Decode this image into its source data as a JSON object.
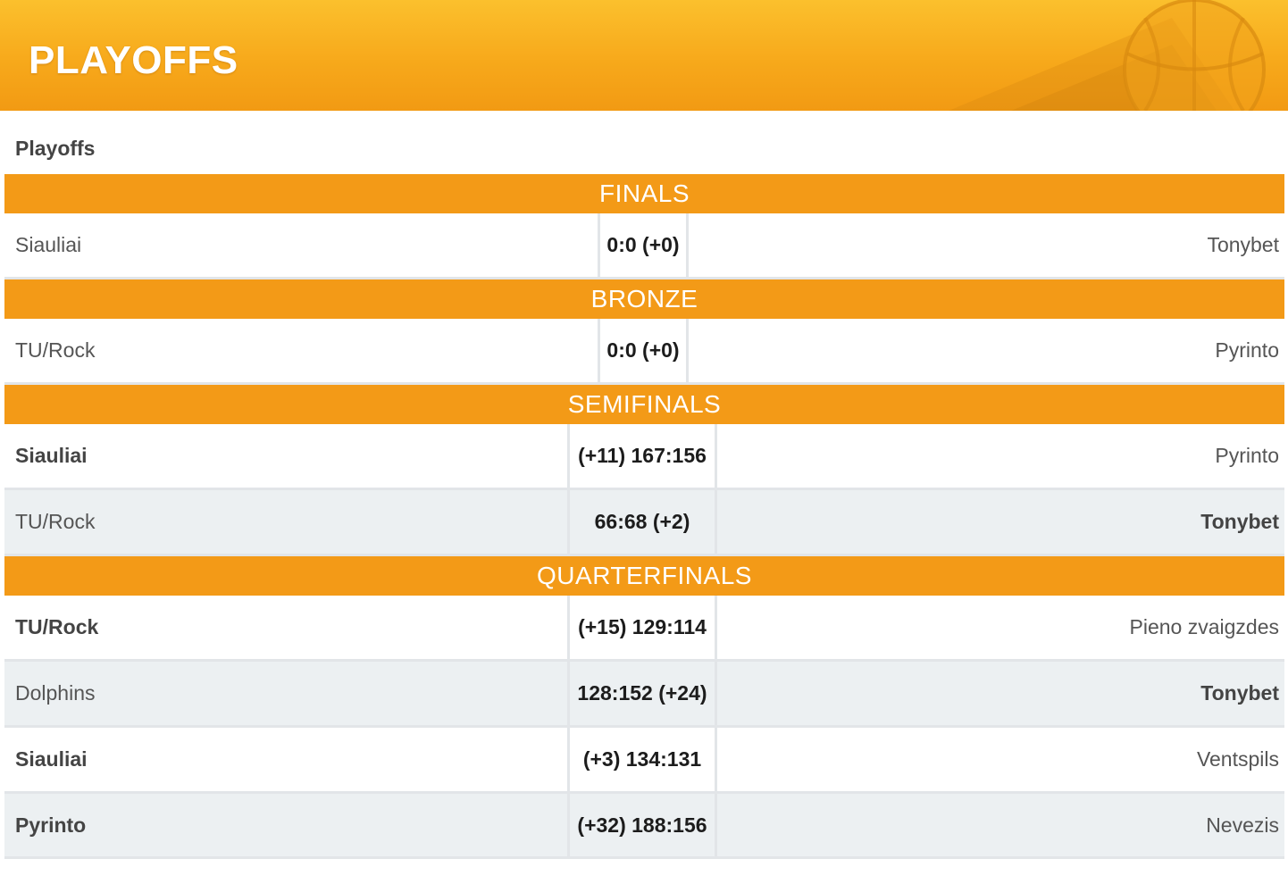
{
  "header": {
    "title": "PLAYOFFS"
  },
  "subtitle": "Playoffs",
  "colors": {
    "header_gradient_top": "#fbc02d",
    "header_gradient_bottom": "#f29a13",
    "section_band": "#f39a17",
    "alt_row": "#ecf0f2",
    "row_separator": "#e2e5e8"
  },
  "sections": [
    {
      "title": "FINALS",
      "matches": [
        {
          "home": "Siauliai",
          "score": "0:0 (+0)",
          "away": "Tonybet"
        }
      ]
    },
    {
      "title": "BRONZE",
      "matches": [
        {
          "home": "TU/Rock",
          "score": "0:0 (+0)",
          "away": "Pyrinto"
        }
      ]
    },
    {
      "title": "SEMIFINALS",
      "matches": [
        {
          "home": "Siauliai",
          "score": "(+11) 167:156",
          "away": "Pyrinto"
        },
        {
          "home": "TU/Rock",
          "score": "66:68 (+2)",
          "away": "Tonybet"
        }
      ]
    },
    {
      "title": "QUARTERFINALS",
      "matches": [
        {
          "home": "TU/Rock",
          "score": "(+15) 129:114",
          "away": "Pieno zvaigzdes"
        },
        {
          "home": "Dolphins",
          "score": "128:152 (+24)",
          "away": "Tonybet"
        },
        {
          "home": "Siauliai",
          "score": "(+3) 134:131",
          "away": "Ventspils"
        },
        {
          "home": "Pyrinto",
          "score": "(+32) 188:156",
          "away": "Nevezis"
        }
      ]
    }
  ]
}
